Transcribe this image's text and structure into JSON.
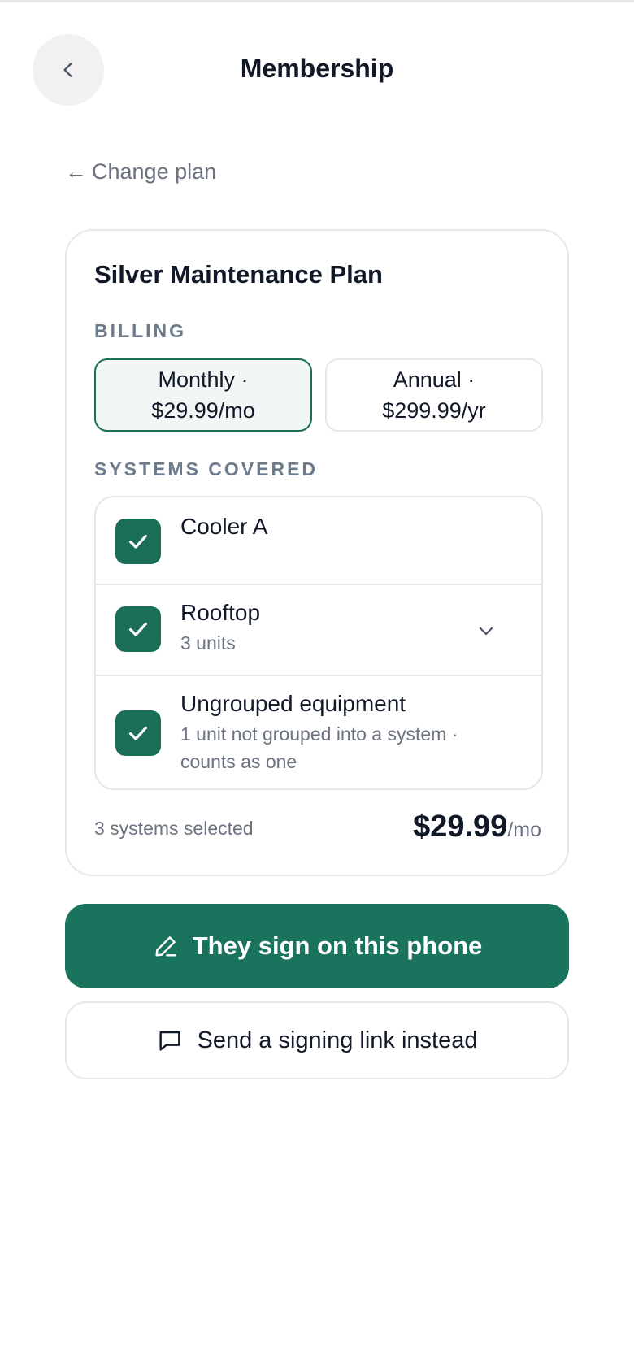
{
  "header": {
    "title": "Membership",
    "back_icon": "chevron-left-icon"
  },
  "nav": {
    "change_plan_arrow": "←",
    "change_plan_label": "Change plan"
  },
  "plan": {
    "title": "Silver Maintenance Plan",
    "billing_label": "BILLING",
    "billing_options": [
      {
        "line1": "Monthly ·",
        "line2": "$29.99/mo",
        "selected": true
      },
      {
        "line1": "Annual ·",
        "line2": "$299.99/yr",
        "selected": false
      }
    ],
    "systems_label": "SYSTEMS COVERED",
    "systems": [
      {
        "name": "Cooler A",
        "sub": "",
        "checked": true,
        "expandable": false
      },
      {
        "name": "Rooftop",
        "sub": "3 units",
        "checked": true,
        "expandable": true
      },
      {
        "name": "Ungrouped equipment",
        "sub_line1": "1 unit not grouped into a system ·",
        "sub_line2": "counts as one",
        "checked": true,
        "expandable": false
      }
    ],
    "summary": {
      "count_text": "3 systems selected",
      "price": "$29.99",
      "unit": "/mo"
    }
  },
  "actions": {
    "primary_label": "They sign on this phone",
    "primary_icon": "pencil-icon",
    "secondary_label": "Send a signing link instead",
    "secondary_icon": "message-icon"
  },
  "colors": {
    "accent": "#1a735c",
    "muted_text": "#6b7280",
    "border": "#e5e7eb"
  }
}
